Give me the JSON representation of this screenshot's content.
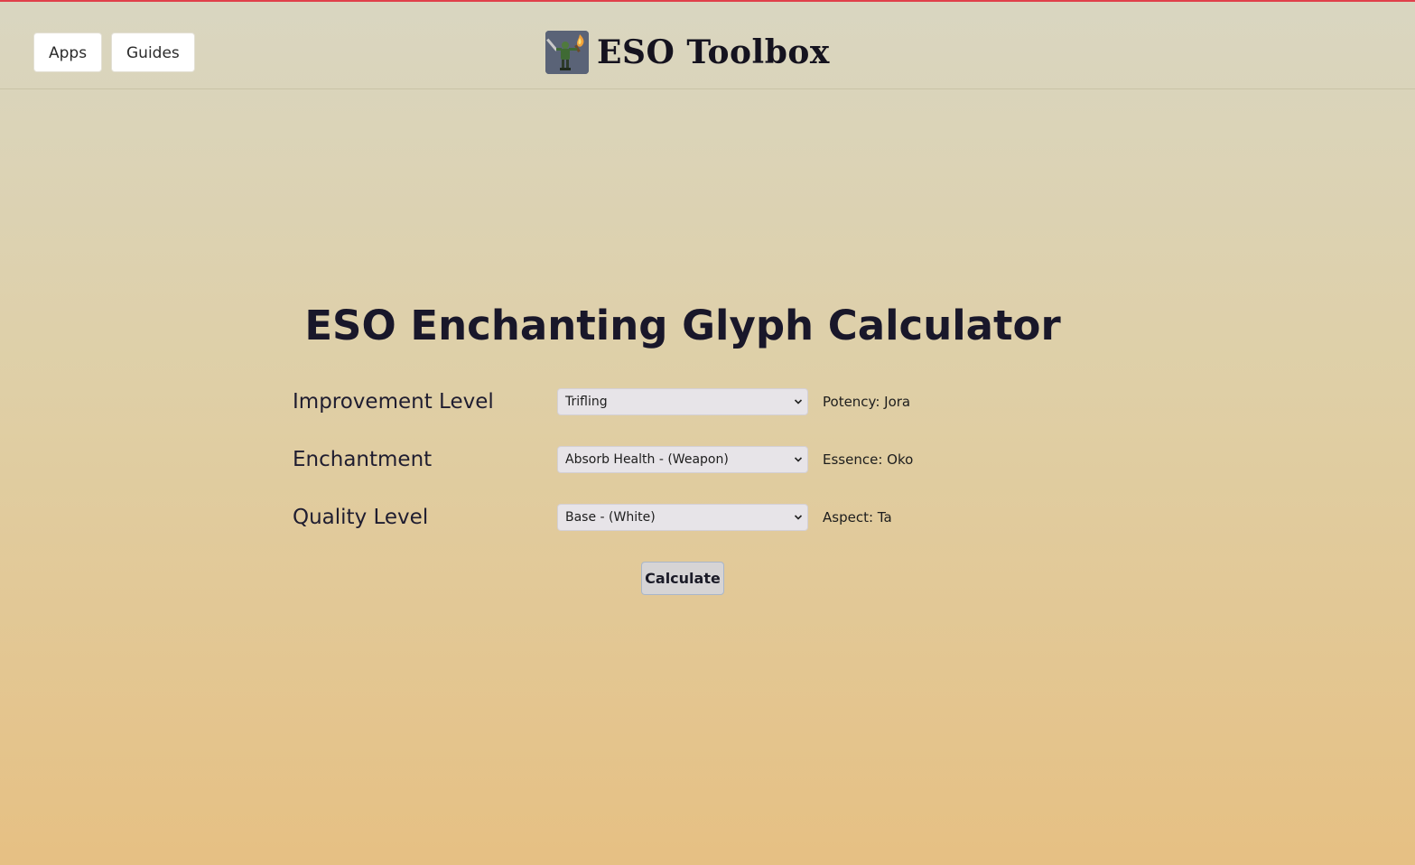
{
  "header": {
    "nav": [
      {
        "label": "Apps"
      },
      {
        "label": "Guides"
      }
    ],
    "logo_icon": "eso-warrior-torch-icon",
    "brand_title": "ESO Toolbox"
  },
  "main": {
    "title": "ESO Enchanting Glyph Calculator",
    "rows": [
      {
        "label": "Improvement Level",
        "selected": "Trifling",
        "result": "Potency: Jora"
      },
      {
        "label": "Enchantment",
        "selected": "Absorb Health - (Weapon)",
        "result": "Essence: Oko"
      },
      {
        "label": "Quality Level",
        "selected": "Base - (White)",
        "result": "Aspect: Ta"
      }
    ],
    "calculate_label": "Calculate"
  },
  "colors": {
    "accent_line": "#e0404a",
    "background_top": "#d9d6c1",
    "background_bottom": "#e6c083",
    "text_dark": "#1c1a2e"
  }
}
